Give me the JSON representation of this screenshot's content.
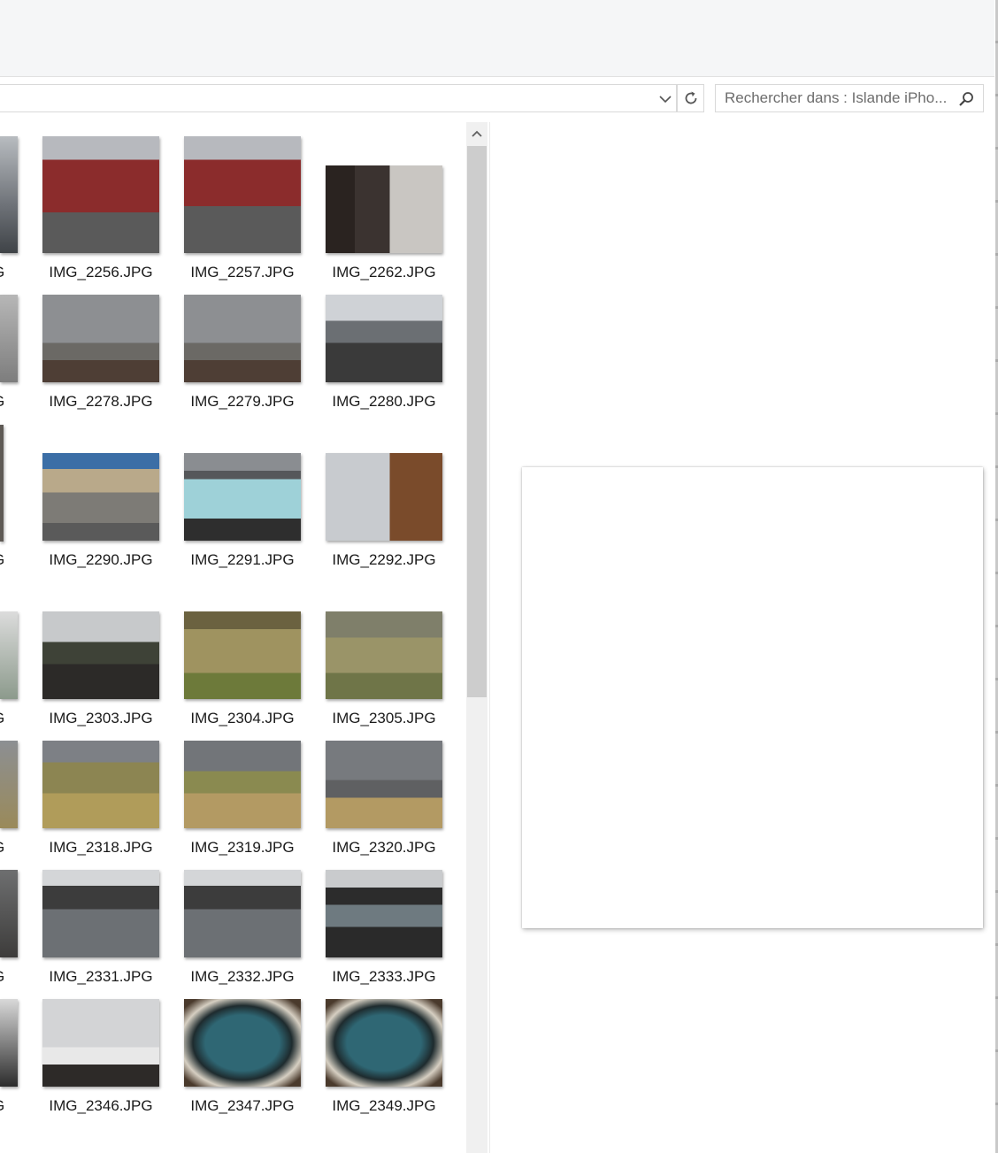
{
  "search": {
    "placeholder": "Rechercher dans : Islande iPho..."
  },
  "icons": {
    "dropdown": "chevron-down-icon",
    "refresh": "refresh-icon",
    "search": "search-icon",
    "scroll_up": "chevron-up-icon"
  },
  "colors": {
    "selection_bg": "#cce8ff",
    "selection_border": "#99d1ff"
  },
  "partial_column_label": "G",
  "files": [
    {
      "name": "IMG_2256.JPG",
      "selected": true
    },
    {
      "name": "IMG_2257.JPG"
    },
    {
      "name": "IMG_2262.JPG"
    },
    {
      "name": "IMG_2278.JPG"
    },
    {
      "name": "IMG_2279.JPG"
    },
    {
      "name": "IMG_2280.JPG"
    },
    {
      "name": "IMG_2290.JPG"
    },
    {
      "name": "IMG_2291.JPG"
    },
    {
      "name": "IMG_2292.JPG"
    },
    {
      "name": "IMG_2303.JPG"
    },
    {
      "name": "IMG_2304.JPG"
    },
    {
      "name": "IMG_2305.JPG"
    },
    {
      "name": "IMG_2318.JPG"
    },
    {
      "name": "IMG_2319.JPG"
    },
    {
      "name": "IMG_2320.JPG"
    },
    {
      "name": "IMG_2331.JPG"
    },
    {
      "name": "IMG_2332.JPG"
    },
    {
      "name": "IMG_2333.JPG"
    },
    {
      "name": "IMG_2346.JPG"
    },
    {
      "name": "IMG_2347.JPG"
    },
    {
      "name": "IMG_2349.JPG"
    }
  ]
}
